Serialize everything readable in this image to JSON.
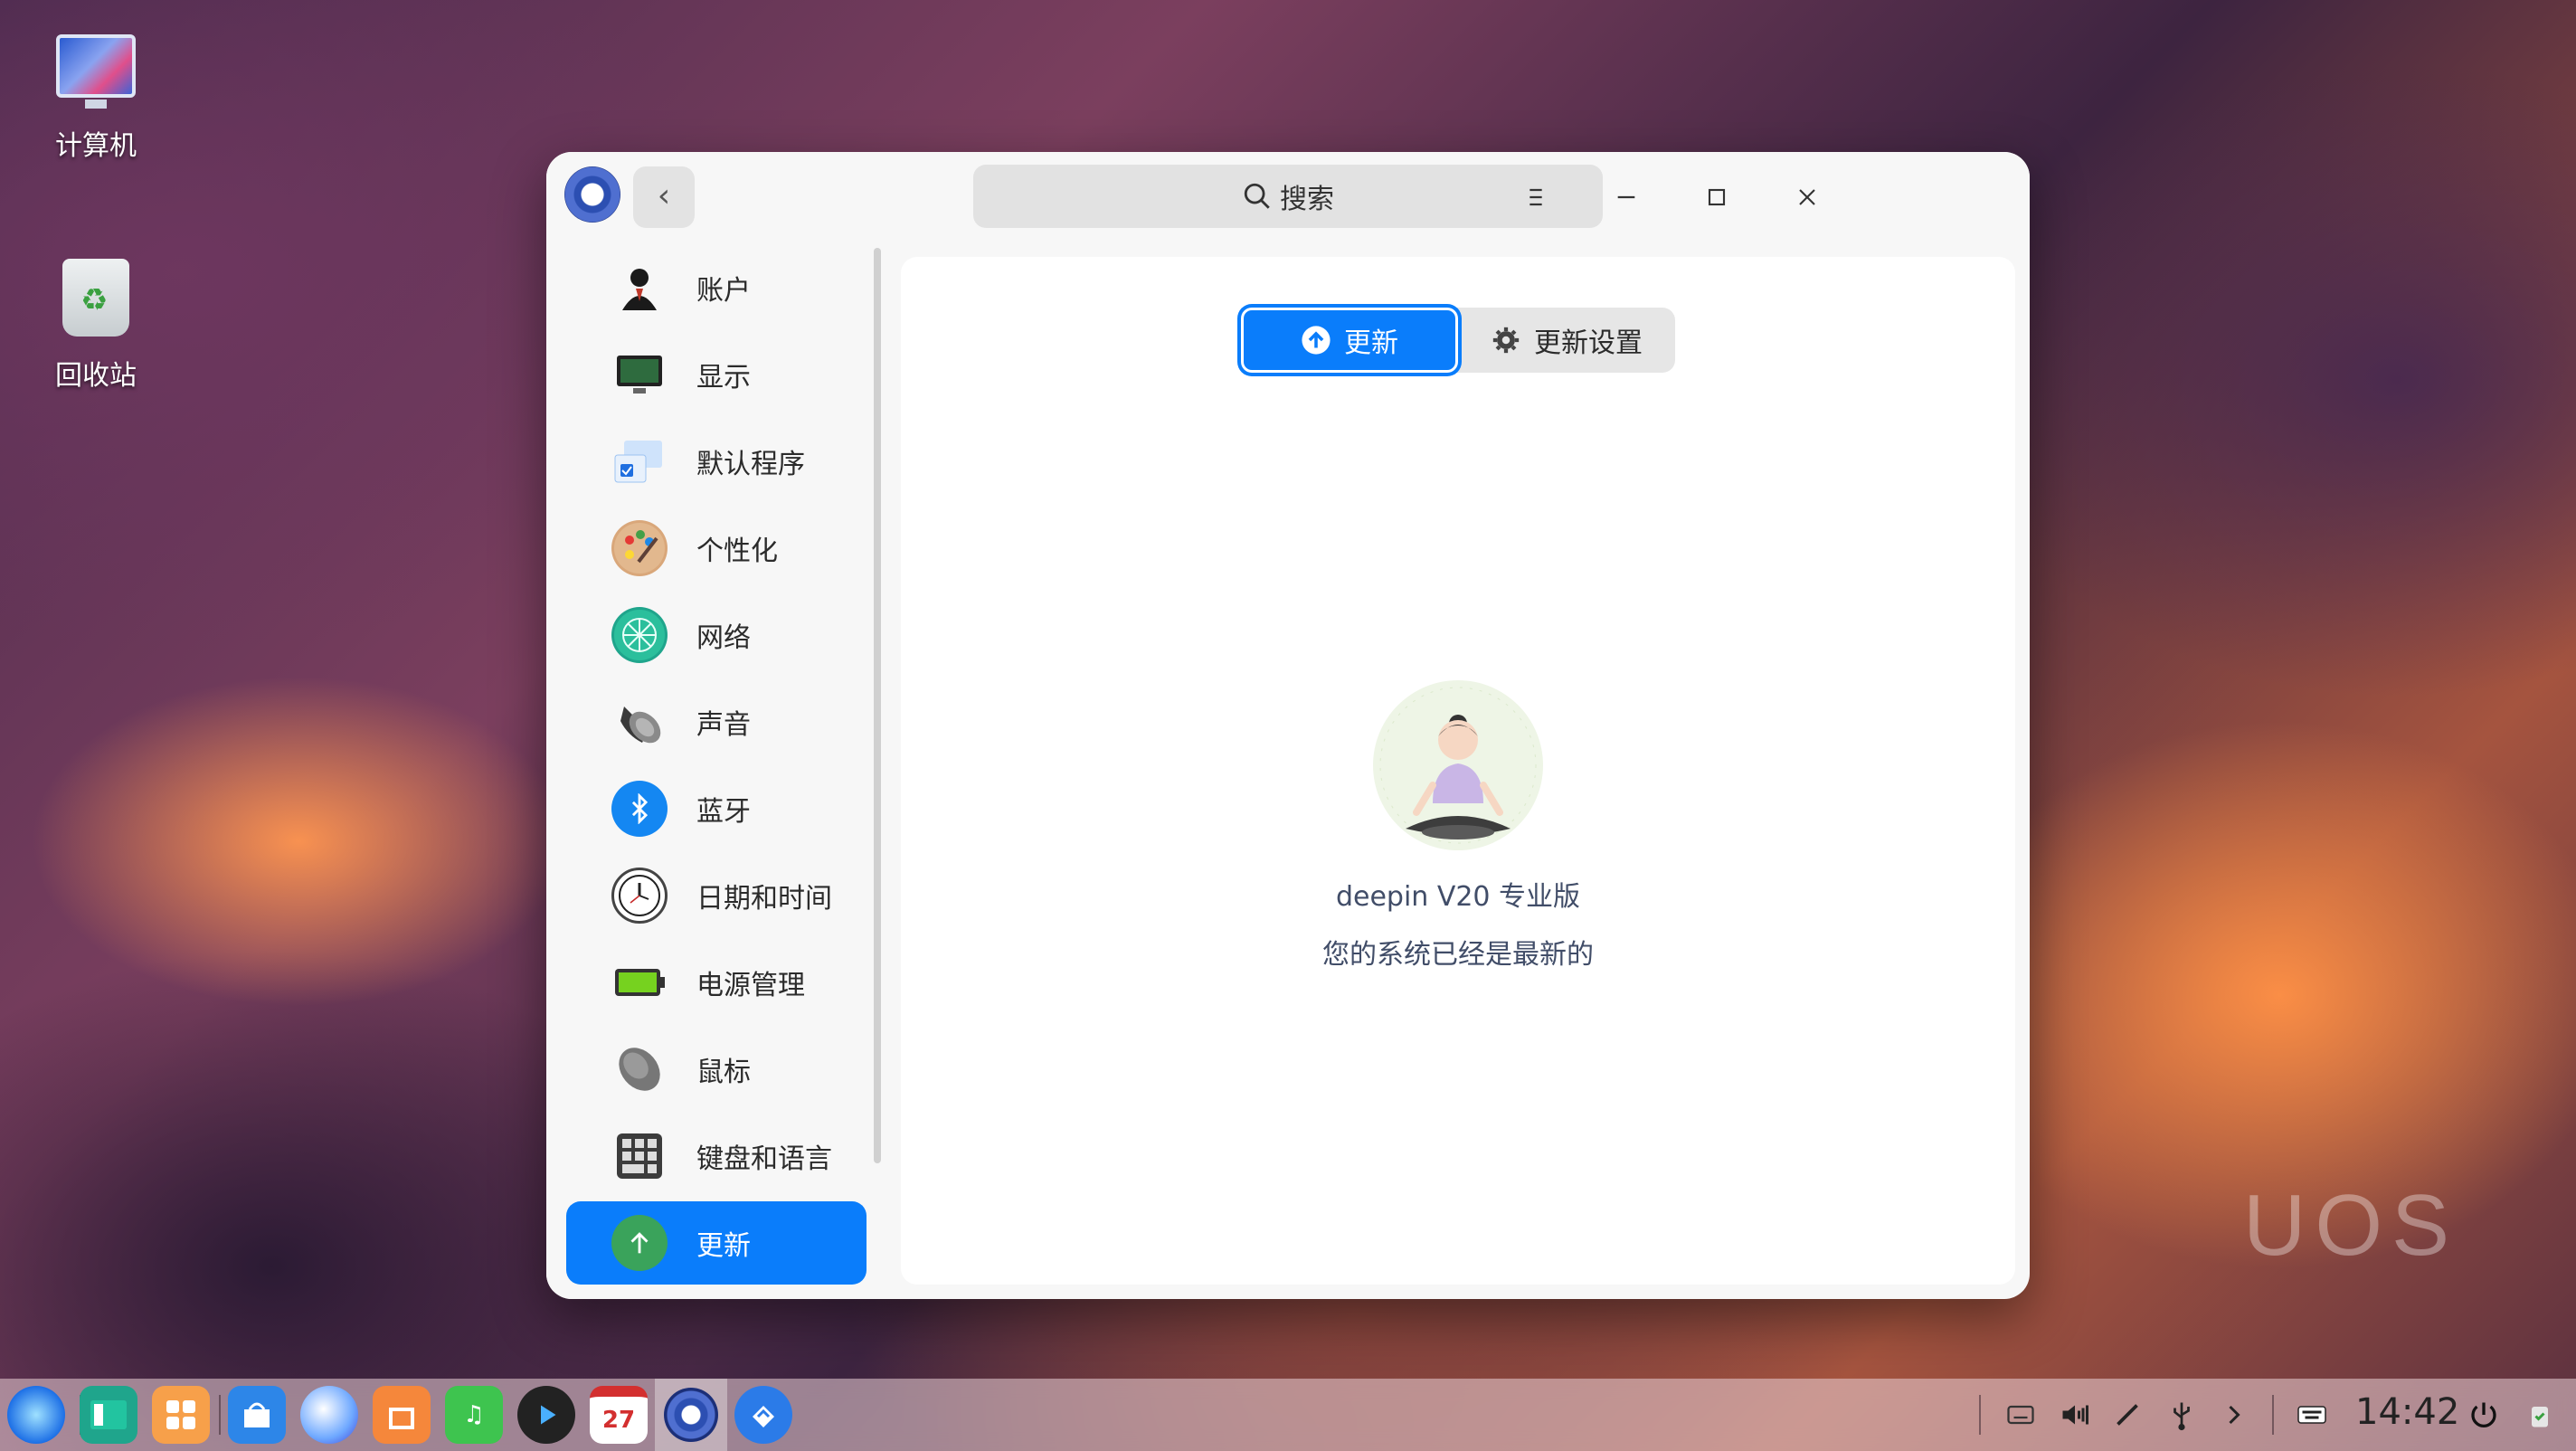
{
  "desktop": {
    "icons": [
      {
        "label": "计算机",
        "icon": "computer-icon"
      },
      {
        "label": "回收站",
        "icon": "trash-icon"
      }
    ],
    "watermark": "UOS"
  },
  "window": {
    "back_symbol": "‹",
    "search_placeholder": "搜索",
    "controls": [
      "menu-icon",
      "minimize-icon",
      "maximize-icon",
      "close-icon"
    ]
  },
  "sidebar": {
    "items": [
      {
        "label": "账户",
        "icon": "account-icon",
        "color": "#222222"
      },
      {
        "label": "显示",
        "icon": "display-icon",
        "color": "#2e6b3e"
      },
      {
        "label": "默认程序",
        "icon": "default-apps-icon",
        "color": "#3d86d8"
      },
      {
        "label": "个性化",
        "icon": "personalization-icon",
        "color": "#b06a3a"
      },
      {
        "label": "网络",
        "icon": "network-icon",
        "color": "#1fa58c"
      },
      {
        "label": "声音",
        "icon": "sound-icon",
        "color": "#5a5a5a"
      },
      {
        "label": "蓝牙",
        "icon": "bluetooth-icon",
        "color": "#1487f2"
      },
      {
        "label": "日期和时间",
        "icon": "clock-icon",
        "color": "#f0f0f0"
      },
      {
        "label": "电源管理",
        "icon": "battery-icon",
        "color": "#6fc21e"
      },
      {
        "label": "鼠标",
        "icon": "mouse-icon",
        "color": "#7a7a7a"
      },
      {
        "label": "键盘和语言",
        "icon": "keyboard-icon",
        "color": "#4a4a4a"
      },
      {
        "label": "更新",
        "icon": "update-icon",
        "color": "#3aa35b",
        "active": true
      }
    ]
  },
  "content": {
    "tabs": [
      {
        "label": "更新",
        "icon": "upload-arrow-icon",
        "active": true
      },
      {
        "label": "更新设置",
        "icon": "gear-icon",
        "active": false
      }
    ],
    "version": "deepin V20 专业版",
    "status": "您的系统已经是最新的"
  },
  "dock": {
    "apps": [
      "launcher-icon",
      "file-manager-icon",
      "multitasking-icon",
      "app-store-icon",
      "browser-icon",
      "shop-icon",
      "music-icon",
      "video-icon",
      "calendar-icon",
      "control-center-icon",
      "remote-assist-icon"
    ],
    "calendar_day": "27",
    "time": "14:42",
    "colors": {
      "accent": "#0a7dfb",
      "active_text": "#ffffff"
    }
  }
}
